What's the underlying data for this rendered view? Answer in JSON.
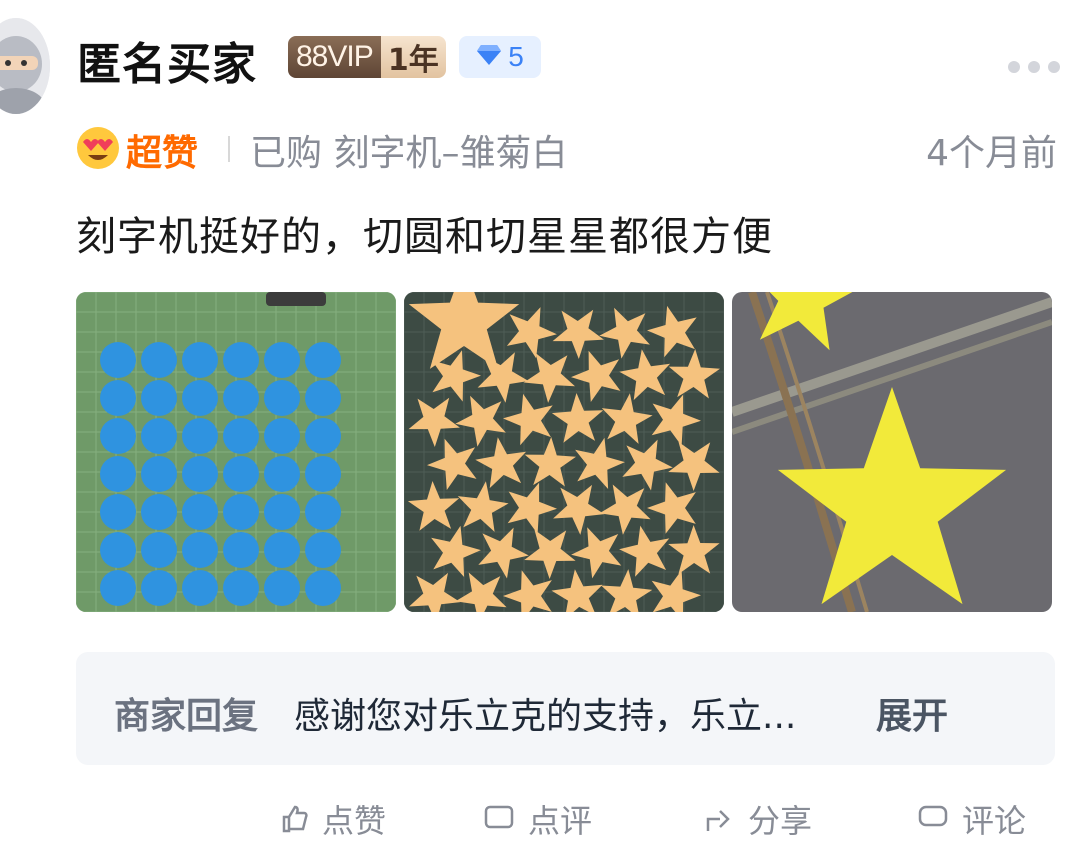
{
  "user": {
    "name": "匿名买家",
    "vip_label": "88VIP",
    "vip_years": "1年",
    "level": "5"
  },
  "rating": {
    "label": "超赞"
  },
  "purchase": {
    "text": "已购 刻字机–雏菊白"
  },
  "time": "4个月前",
  "review": {
    "text": "刻字机挺好的，切圆和切星星都很方便"
  },
  "photos": [
    {
      "name": "blue-circles-photo"
    },
    {
      "name": "orange-stars-photo"
    },
    {
      "name": "yellow-star-photo"
    }
  ],
  "merchant_reply": {
    "label": "商家回复",
    "text": "感谢您对乐立克的支持，乐立...",
    "expand_label": "展开"
  },
  "actions": {
    "like_label": "点赞",
    "comment_label": "点评",
    "share_label": "分享",
    "reply_label": "评论"
  },
  "colors": {
    "accent_orange": "#ff6a00",
    "gem_blue": "#3b82f6",
    "muted_text": "#888c96"
  }
}
